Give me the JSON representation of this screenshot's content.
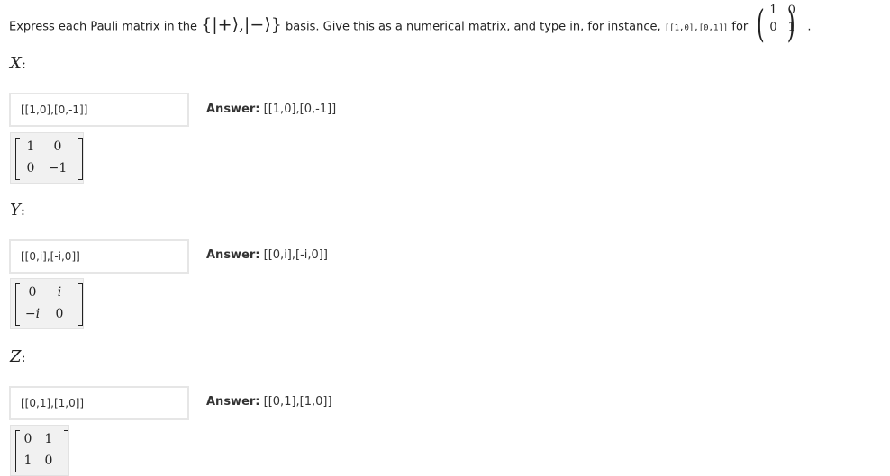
{
  "prompt": {
    "text_before": "Express each Pauli matrix in the ",
    "basis": "{|+⟩,|−⟩}",
    "text_middle": " basis. Give this as a numerical matrix, and type in, for instance, ",
    "example_code": "[[1,0],[0,1]]",
    "text_for": " for ",
    "example_matrix": [
      [
        "1",
        "0"
      ],
      [
        "0",
        "1"
      ]
    ],
    "text_end": "."
  },
  "questions": [
    {
      "label": "X",
      "input_value": "[[1,0],[0,-1]]",
      "answer_label": "Answer:",
      "answer_value": "[[1,0],[0,-1]]",
      "preview": [
        [
          "1",
          "0"
        ],
        [
          "0",
          "−1"
        ]
      ]
    },
    {
      "label": "Y",
      "input_value": "[[0,i],[-i,0]]",
      "answer_label": "Answer:",
      "answer_value": "[[0,i],[-i,0]]",
      "preview": [
        [
          "0",
          "i"
        ],
        [
          "−i",
          "0"
        ]
      ]
    },
    {
      "label": "Z",
      "input_value": "[[0,1],[1,0]]",
      "answer_label": "Answer:",
      "answer_value": "[[0,1],[1,0]]",
      "preview": [
        [
          "0",
          "1"
        ],
        [
          "1",
          "0"
        ]
      ]
    }
  ]
}
